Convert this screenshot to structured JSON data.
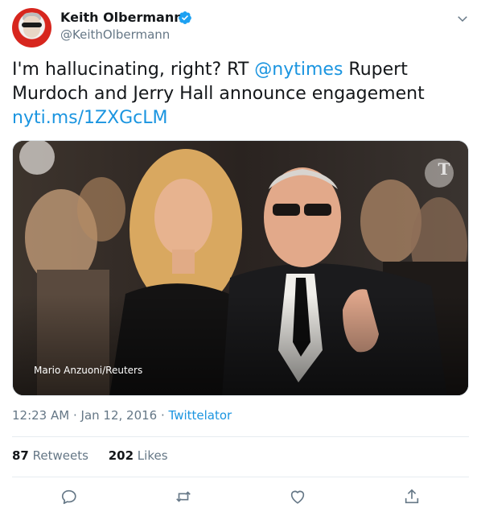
{
  "author": {
    "display_name": "Keith Olbermann",
    "handle": "@KeithOlbermann",
    "avatar_icon": "avatar-photo",
    "verified_icon": "verified-badge-icon"
  },
  "tweet": {
    "text_before": "I'm hallucinating, right? RT ",
    "mention": "@nytimes",
    "text_middle": " Rupert Murdoch and Jerry Hall announce engagement ",
    "url": "nyti.ms/1ZXGcLM"
  },
  "media": {
    "photo_credit": "Mario Anzuoni/Reuters",
    "watermark_icon": "nyt-logo-icon"
  },
  "meta": {
    "time": "12:23 AM",
    "separator1": " · ",
    "date": "Jan 12, 2016",
    "separator2": " · ",
    "source": "Twittelator"
  },
  "stats": {
    "retweets_count": "87",
    "retweets_label": " Retweets",
    "likes_count": "202",
    "likes_label": " Likes"
  },
  "actions": {
    "icons": [
      "reply-icon",
      "retweet-icon",
      "like-icon",
      "share-icon"
    ]
  },
  "colors": {
    "link": "#1b95e0",
    "secondary_text": "#657786",
    "primary_text": "#14171a",
    "divider": "#e6ecf0",
    "verified": "#1da1f2"
  }
}
